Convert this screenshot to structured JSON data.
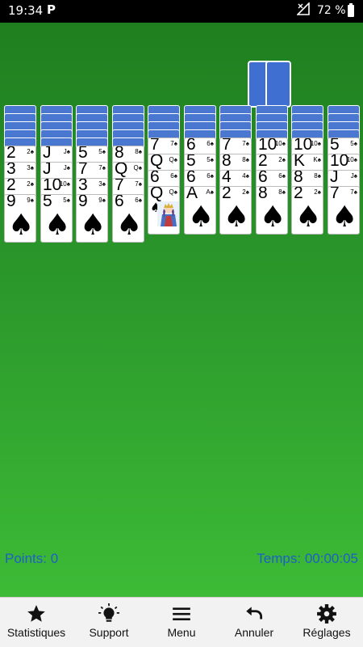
{
  "status_bar": {
    "time": "19:34",
    "app_icon": "P",
    "battery": "72 %"
  },
  "game": {
    "suit": "♠",
    "stock_piles": 2,
    "columns": [
      {
        "hidden": 5,
        "cards": [
          "2",
          "3",
          "2",
          "9"
        ]
      },
      {
        "hidden": 5,
        "cards": [
          "J",
          "J",
          "10",
          "5"
        ]
      },
      {
        "hidden": 5,
        "cards": [
          "5",
          "7",
          "3",
          "9"
        ]
      },
      {
        "hidden": 5,
        "cards": [
          "8",
          "Q",
          "7",
          "6"
        ]
      },
      {
        "hidden": 4,
        "cards": [
          "7",
          "Q",
          "6",
          "Q"
        ]
      },
      {
        "hidden": 4,
        "cards": [
          "6",
          "5",
          "6",
          "A"
        ]
      },
      {
        "hidden": 4,
        "cards": [
          "7",
          "8",
          "4",
          "2"
        ]
      },
      {
        "hidden": 4,
        "cards": [
          "10",
          "2",
          "6",
          "8"
        ]
      },
      {
        "hidden": 4,
        "cards": [
          "10",
          "K",
          "8",
          "2"
        ]
      },
      {
        "hidden": 4,
        "cards": [
          "5",
          "10",
          "J",
          "7"
        ]
      }
    ]
  },
  "score": {
    "points_label": "Points: 0",
    "time_label": "Temps: 00:00:05"
  },
  "toolbar": {
    "items": [
      {
        "label": "Statistiques",
        "icon": "star-icon"
      },
      {
        "label": "Support",
        "icon": "lightbulb-icon"
      },
      {
        "label": "Menu",
        "icon": "menu-icon"
      },
      {
        "label": "Annuler",
        "icon": "undo-icon"
      },
      {
        "label": "Réglages",
        "icon": "gear-icon"
      }
    ]
  },
  "colors": {
    "felt_top": "#1f7f1f",
    "felt_bottom": "#3dbb36",
    "card_back": "#4a78d0",
    "score_text": "#1e5fc7"
  }
}
